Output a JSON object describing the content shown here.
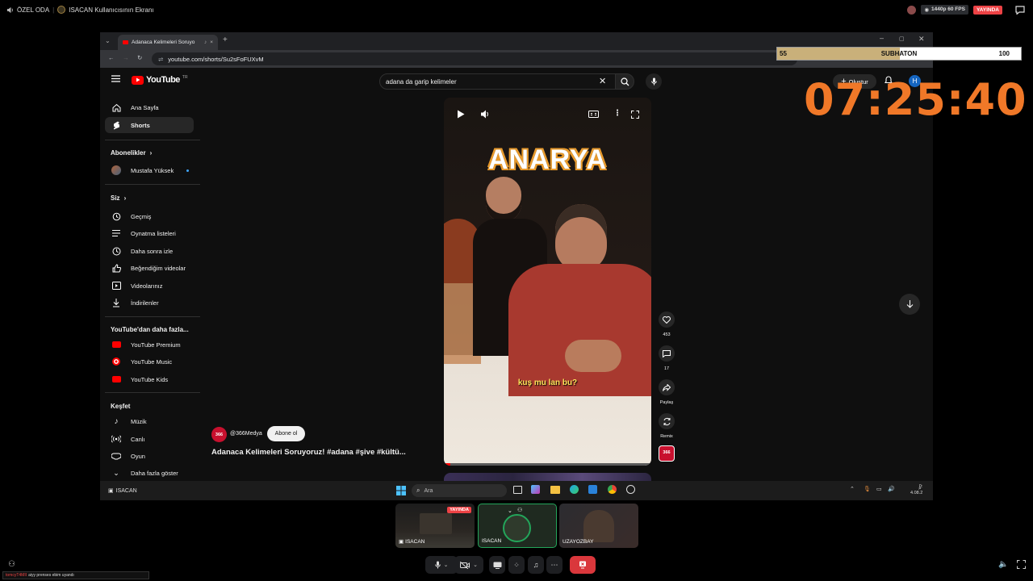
{
  "discord": {
    "room_name": "ÖZEL ODA",
    "screen_title": "ISACAN Kullanıcısının Ekranı",
    "quality": "1440p 60 FPS",
    "live_badge": "YAYINDA"
  },
  "browser": {
    "tab_title": "Adanaca Kelimeleri Soruyo",
    "url": "youtube.com/shorts/Su2sFoFUXvM"
  },
  "youtube": {
    "logo_text": "YouTube",
    "logo_sup": "TR",
    "search_query": "adana da garip kelimeler",
    "create_label": "Oluştur",
    "avatar_letter": "H",
    "sidebar": {
      "items_top": [
        {
          "label": "Ana Sayfa",
          "icon": "home-icon"
        },
        {
          "label": "Shorts",
          "icon": "shorts-icon"
        }
      ],
      "subscriptions_heading": "Abonelikler",
      "subscriptions": [
        {
          "label": "Mustafa Yüksek"
        }
      ],
      "you_heading": "Siz",
      "you_items": [
        {
          "label": "Geçmiş",
          "icon": "history-icon"
        },
        {
          "label": "Oynatma listeleri",
          "icon": "playlist-icon"
        },
        {
          "label": "Daha sonra izle",
          "icon": "clock-icon"
        },
        {
          "label": "Beğendiğim videolar",
          "icon": "thumbs-up-icon"
        },
        {
          "label": "Videolarınız",
          "icon": "video-icon"
        },
        {
          "label": "İndirilenler",
          "icon": "download-icon"
        }
      ],
      "more_heading": "YouTube'dan daha fazla...",
      "more_items": [
        {
          "label": "YouTube Premium"
        },
        {
          "label": "YouTube Music"
        },
        {
          "label": "YouTube Kids"
        }
      ],
      "explore_heading": "Keşfet",
      "explore_items": [
        {
          "label": "Müzik",
          "icon": "music-icon"
        },
        {
          "label": "Canlı",
          "icon": "live-icon"
        },
        {
          "label": "Oyun",
          "icon": "gamepad-icon"
        },
        {
          "label": "Daha fazla göster",
          "icon": "chevron-down-icon"
        }
      ]
    },
    "short": {
      "overlay_title": "ANARYA",
      "subtitle": "kuş mu lan bu?",
      "channel": "@366Medya",
      "subscribe_label": "Abone ol",
      "title": "Adanaca Kelimeleri Soruyoruz! #adana #şive #kültü...",
      "likes": "453",
      "comments": "17",
      "share_label": "Paylaş",
      "remix_label": "Remix",
      "channel_badge": "366"
    }
  },
  "overlay": {
    "subathon_left": "55",
    "subathon_label": "SUBHATON",
    "subathon_right": "100",
    "timer": "07:25:40"
  },
  "taskbar": {
    "app_label": "ISACAN",
    "search_placeholder": "Ara",
    "clock_time": "0:",
    "clock_date": "4.08.2"
  },
  "participants": [
    {
      "name": "ISACAN",
      "badge": "YAYINDA"
    },
    {
      "name": "ISACAN"
    },
    {
      "name": "UZAYOZBAY"
    }
  ],
  "chat": {
    "user": "tomcyT4MII",
    "message": "aiyy prenses ebim uyandı"
  },
  "colors": {
    "yt_red": "#ff0000",
    "timer_orange": "#f07828",
    "live_red": "#ed4245",
    "subathon_fill": "#c9b07a",
    "end_call_red": "#da373c"
  }
}
